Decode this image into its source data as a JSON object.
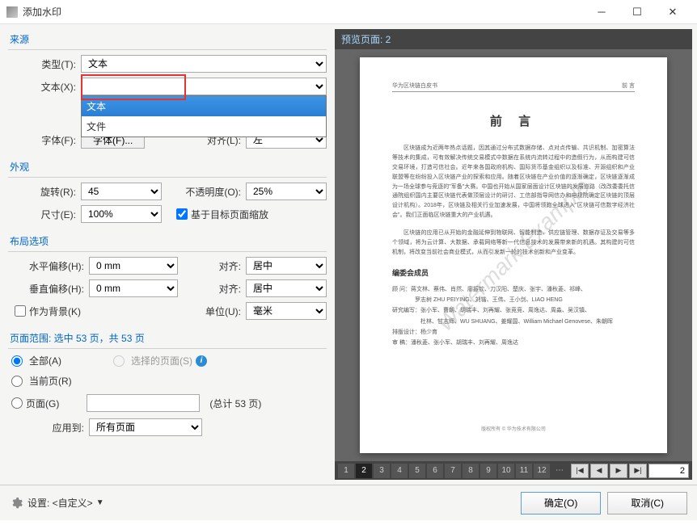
{
  "window": {
    "title": "添加水印"
  },
  "source": {
    "title": "来源",
    "type_label": "类型(T):",
    "type_value": "文本",
    "text_label": "文本(X):",
    "text_value": "",
    "dropdown": {
      "opt1": "文本",
      "opt2": "文件"
    },
    "font_label": "字体(F):",
    "font_btn": "字体(F)...",
    "align_label": "对齐(L):",
    "align_value": "左"
  },
  "appearance": {
    "title": "外观",
    "rotate_label": "旋转(R):",
    "rotate_value": "45",
    "opacity_label": "不透明度(O):",
    "opacity_value": "25%",
    "size_label": "尺寸(E):",
    "size_value": "100%",
    "scale_checkbox": "基于目标页面缩放"
  },
  "layout": {
    "title": "布局选项",
    "hoff_label": "水平偏移(H):",
    "hoff_value": "0 mm",
    "voff_label": "垂直偏移(H):",
    "voff_value": "0 mm",
    "align_label": "对齐:",
    "align_h": "居中",
    "align_v": "居中",
    "bg_checkbox": "作为背景(K)",
    "unit_label": "单位(U):",
    "unit_value": "毫米"
  },
  "pagerange": {
    "title": "页面范围: 选中 53 页，共 53 页",
    "all": "全部(A)",
    "current": "当前页(R)",
    "selected": "选择的页面(S)",
    "pages": "页面(G)",
    "total": "(总计 53 页)",
    "apply_label": "应用到:",
    "apply_value": "所有页面"
  },
  "preview": {
    "header": "预览页面: 2",
    "doc_title": "华为区块链白皮书",
    "doc_sec": "前 言",
    "main_title": "前  言",
    "para1": "区块链成为近两年热点话题，因其通过分布式数据存储、点对点传输、共识机制、加密算法等技术的集成，可有效解决传统交易模式中数据在系统内流转过程中的造假行为，从而构建可信交易环境，打造可信社会。近年来各国政府机构、国际货币基金组织以及标准、开源组织和产业联盟等在纷纷投入区块链产业的探索和应用。随着区块链在产业价值的逐渐确定，区块链逐渐成为一场全球参与竞逐的\"军备\"大赛。中国也开始从国家层面设计区块链的发展道路（改改委委托信通院组织国内主要区块链代表做顶层设计的研讨、工信部指导网信办和电规院确定区块链的顶层设计机构）。2018年，区块链及相关行业加速发展，中国将领跑全球进入\"区块链可信数字经济社会\"。我们正面临区块链重大的产业机遇。",
    "para2": "区块链的应用已从开始的金融延伸到物联网、智能制造、供应链管理、数据存证及交易等多个领域，将为云计算、大数据、承载网络等新一代信息技术的发展带来新的机遇。其构建的可信机制，将改变当前社会商业模式，从而引发新一轮的技术创新和产业变革。",
    "subtitle": "编委会成员",
    "l1": "顾 问：蒋文林、蔡伟、肖然、廖振钦、刀汉阳、楚庆、张宇、潘秋菱、祁峰、",
    "l2": "　　　　罗志树 ZHU PEIYING、刘锴、王伟、王小剑、LIAO HENG",
    "l3": "研究编写：张小军、曹朝、胡瑞丰、刘再耀、张竞竞、周逸达、周淼、吴汉镇、",
    "l4": "　　　　　杜林、甘志辉、WU SHUANG、姜耀国、William Michael Genovese、朱朝晖",
    "l5": "排版设计：杨少育",
    "l6": "审 稿：潘秋菱、张小军、胡瑞丰、刘再耀、周逸达",
    "footer": "版权所有 © 华为技术有限公司",
    "watermark": "Watermark Example"
  },
  "pager": {
    "nums": [
      "1",
      "2",
      "3",
      "4",
      "5",
      "6",
      "7",
      "8",
      "9",
      "10",
      "11",
      "12"
    ],
    "current": "2"
  },
  "bottom": {
    "settings": "设置: <自定义>",
    "ok": "确定(O)",
    "cancel": "取消(C)"
  }
}
